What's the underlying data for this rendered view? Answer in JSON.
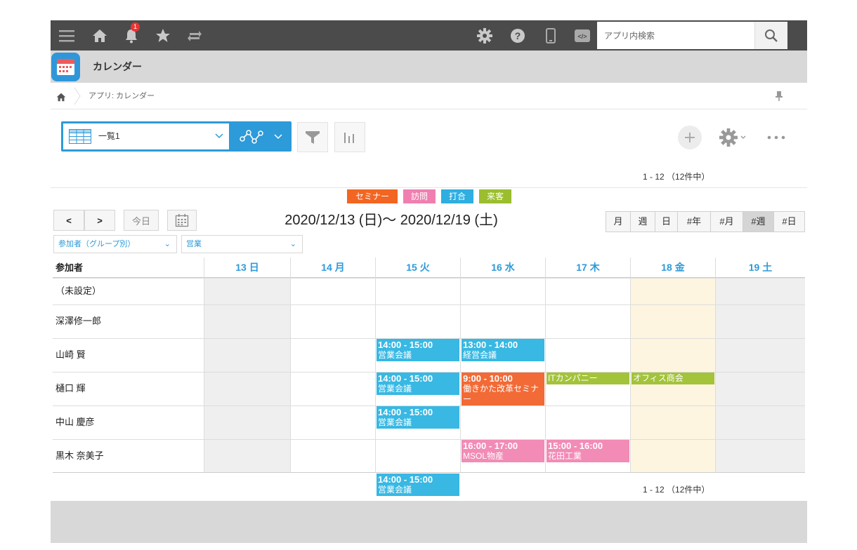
{
  "topbar": {
    "notification_count": "1",
    "search_placeholder": "アプリ内検索",
    "icons": [
      "menu-icon",
      "home-icon",
      "bell-icon",
      "star-icon",
      "recent-icon",
      "gear-icon",
      "help-icon",
      "mobile-icon",
      "code-icon",
      "search-icon"
    ]
  },
  "app": {
    "title": "カレンダー"
  },
  "breadcrumb": {
    "text": "アプリ: カレンダー"
  },
  "toolbar": {
    "view_name": "一覧1"
  },
  "pagination": {
    "top": "1 - 12 （12件中）",
    "bottom": "1 - 12 （12件中）"
  },
  "legend": [
    {
      "label": "セミナー",
      "color": "#f26522"
    },
    {
      "label": "訪問",
      "color": "#f07fb0"
    },
    {
      "label": "打合",
      "color": "#2faee0"
    },
    {
      "label": "来客",
      "color": "#9bbd2e"
    }
  ],
  "nav": {
    "prev": "<",
    "next": ">",
    "today": "今日",
    "date_range": "2020/12/13 (日)〜 2020/12/19 (土)",
    "modes": [
      "月",
      "週",
      "日",
      "#年",
      "#月",
      "#週",
      "#日"
    ],
    "active_mode": "#週"
  },
  "filters": {
    "group": "参加者（グループ別）",
    "dept": "営業"
  },
  "grid": {
    "header_label": "参加者",
    "days": [
      "13 日",
      "14 月",
      "15 火",
      "16 水",
      "17 木",
      "18 金",
      "19 土"
    ],
    "rows": [
      "（未設定）",
      "深澤修一郎",
      "山崎 賢",
      "樋口 輝",
      "中山 慶彦",
      "黒木 奈美子"
    ],
    "events": [
      {
        "row": 1,
        "day": 1,
        "time": "14:00 - 15:00",
        "title": "営業会議",
        "color": "#38b8e3"
      },
      {
        "row": 1,
        "day": 2,
        "time": "13:00 - 14:00",
        "title": "経営会議",
        "color": "#38b8e3"
      },
      {
        "row": 2,
        "day": 1,
        "time": "14:00 - 15:00",
        "title": "営業会議",
        "color": "#38b8e3"
      },
      {
        "row": 2,
        "day": 2,
        "time": "9:00 - 10:00",
        "title": "働きかた改革セミナー",
        "color": "#f26a36"
      },
      {
        "row": 2,
        "day": 3,
        "time": "",
        "title": "ITカンパニー",
        "color": "#a3c33a"
      },
      {
        "row": 2,
        "day": 4,
        "time": "",
        "title": "オフィス商会",
        "color": "#a3c33a"
      },
      {
        "row": 3,
        "day": 1,
        "time": "14:00 - 15:00",
        "title": "営業会議",
        "color": "#38b8e3"
      },
      {
        "row": 4,
        "day": 2,
        "time": "16:00 - 17:00",
        "title": "MSOL物産",
        "color": "#f28bb6"
      },
      {
        "row": 4,
        "day": 3,
        "time": "15:00 - 16:00",
        "title": "花田工業",
        "color": "#f28bb6"
      },
      {
        "row": 5,
        "day": 1,
        "time": "14:00 - 15:00",
        "title": "営業会議",
        "color": "#38b8e3"
      }
    ]
  }
}
